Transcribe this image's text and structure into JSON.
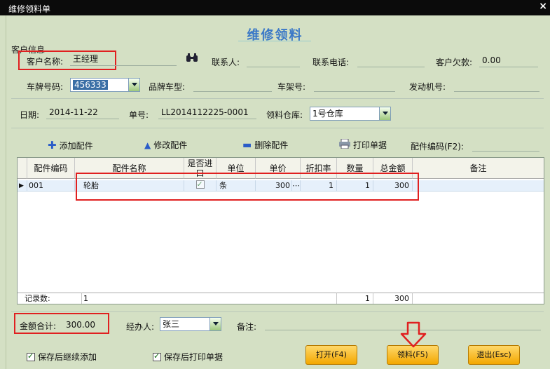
{
  "window": {
    "title": "维修领料单",
    "close_glyph": "×"
  },
  "heading": "维修领料",
  "group_label": "客户信息",
  "customer": {
    "name_label": "客户名称:",
    "name_value": "王经理",
    "contact_label": "联系人:",
    "contact_value": "",
    "phone_label": "联系电话:",
    "phone_value": "",
    "debt_label": "客户欠款:",
    "debt_value": "0.00"
  },
  "vehicle": {
    "plate_label": "车牌号码:",
    "plate_value": "456333",
    "brand_label": "品牌车型:",
    "brand_value": "",
    "frame_label": "车架号:",
    "frame_value": "",
    "engine_label": "发动机号:",
    "engine_value": ""
  },
  "order": {
    "date_label": "日期:",
    "date_value": "2014-11-22",
    "no_label": "单号:",
    "no_value": "LL2014112225-0001",
    "warehouse_label": "领料仓库:",
    "warehouse_value": "1号仓库"
  },
  "toolbar": {
    "add": "添加配件",
    "edit": "修改配件",
    "delete": "删除配件",
    "print": "打印单据",
    "code_label": "配件编码(F2):",
    "code_value": ""
  },
  "grid": {
    "columns": [
      "配件编码",
      "配件名称",
      "是否进口",
      "单位",
      "单价",
      "折扣率",
      "数量",
      "总金额",
      "备注"
    ],
    "rows": [
      {
        "code": "001",
        "name": "轮胎",
        "unit": "条",
        "price": "300",
        "discount": "1",
        "qty": "1",
        "total": "300",
        "note": ""
      }
    ],
    "footer": {
      "count_label": "记录数:",
      "count_value": "1",
      "qty_sum": "1",
      "total_sum": "300"
    }
  },
  "summary": {
    "amount_label": "金额合计:",
    "amount_value": "300.00",
    "handler_label": "经办人:",
    "handler_value": "张三",
    "note_label": "备注:",
    "note_value": ""
  },
  "options": {
    "continue_add": "保存后继续添加",
    "print_after_save": "保存后打印单据"
  },
  "buttons": {
    "open": "打开(F4)",
    "pick": "领料(F5)",
    "exit": "退出(Esc)"
  },
  "colors": {
    "background": "#d4e0c4",
    "heading": "#3a78c7",
    "annotation": "#e02020",
    "button": "#f3a700"
  }
}
